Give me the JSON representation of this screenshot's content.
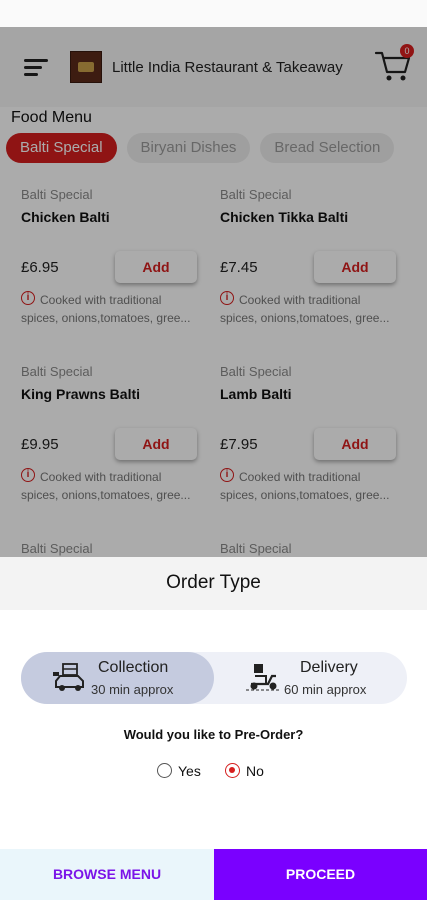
{
  "header": {
    "restaurant_name": "Little India Restaurant & Takeaway",
    "cart_count": "0",
    "icons": [
      "hamburger-menu-icon",
      "cart-icon"
    ]
  },
  "menu": {
    "title": "Food Menu",
    "tabs": [
      {
        "label": "Balti Special",
        "active": true
      },
      {
        "label": "Biryani Dishes",
        "active": false
      },
      {
        "label": "Bread Selection",
        "active": false
      }
    ],
    "items": [
      {
        "category": "Balti Special",
        "name": "Chicken Balti",
        "price": "£6.95",
        "add_label": "Add",
        "description": "Cooked with traditional spices, onions,tomatoes, gree..."
      },
      {
        "category": "Balti Special",
        "name": "Chicken Tikka Balti",
        "price": "£7.45",
        "add_label": "Add",
        "description": "Cooked with traditional spices, onions,tomatoes, gree..."
      },
      {
        "category": "Balti Special",
        "name": "King Prawns Balti",
        "price": "£9.95",
        "add_label": "Add",
        "description": "Cooked with traditional spices, onions,tomatoes, gree..."
      },
      {
        "category": "Balti Special",
        "name": "Lamb Balti",
        "price": "£7.95",
        "add_label": "Add",
        "description": "Cooked with traditional spices, onions,tomatoes, gree..."
      },
      {
        "category": "Balti Special"
      },
      {
        "category": "Balti Special"
      }
    ]
  },
  "order_type": {
    "title": "Order Type",
    "options": [
      {
        "label": "Collection",
        "sub": "30 min approx",
        "selected": true,
        "icon": "collection-icon"
      },
      {
        "label": "Delivery",
        "sub": "60 min approx",
        "selected": false,
        "icon": "delivery-scooter-icon"
      }
    ],
    "preorder_question": "Would you like to Pre-Order?",
    "preorder_options": [
      {
        "label": "Yes",
        "checked": false
      },
      {
        "label": "No",
        "checked": true
      }
    ]
  },
  "footer": {
    "browse_label": "BROWSE MENU",
    "proceed_label": "PROCEED"
  },
  "colors": {
    "accent_red": "#d61f1f",
    "purple": "#7a00ff",
    "segment_selected": "#c5cbdf"
  }
}
